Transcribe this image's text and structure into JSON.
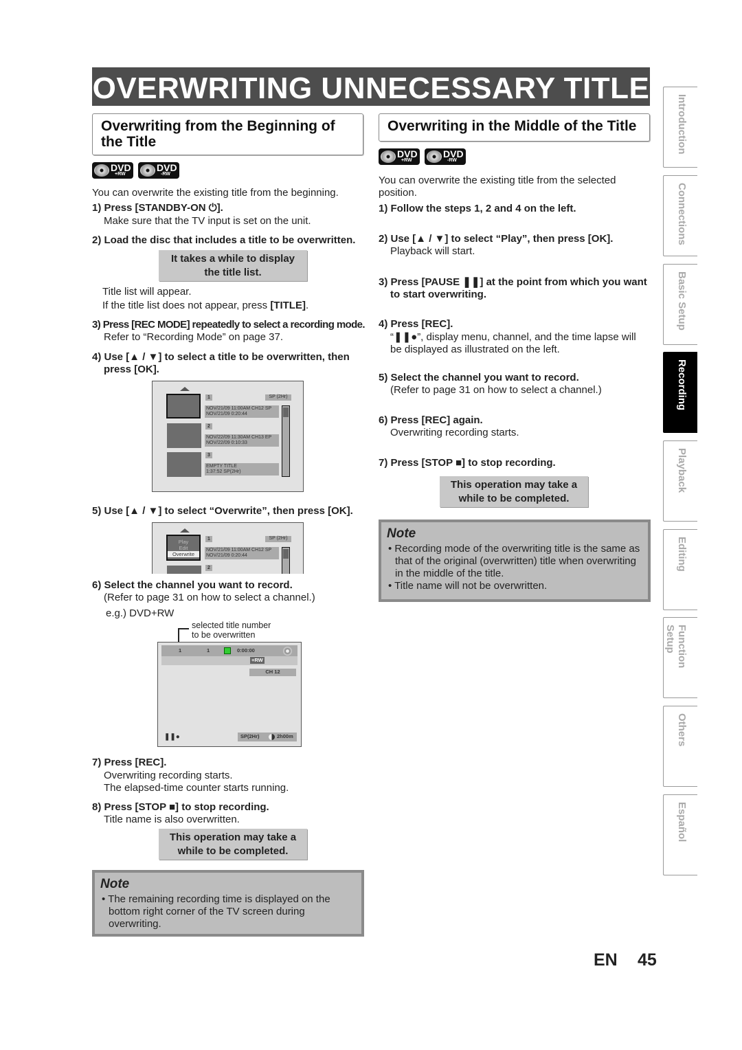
{
  "title": "OVERWRITING UNNECESSARY TITLE",
  "left": {
    "heading": [
      "Overwriting from the Beginning of",
      "the Title"
    ],
    "logos": [
      {
        "main": "DVD",
        "sub": "+RW"
      },
      {
        "main": "DVD",
        "sub": "-RW"
      }
    ],
    "intro": "You can overwrite the existing title from the beginning.",
    "s1": "1) Press [STANDBY-ON ⏻].",
    "s1a": "Make sure that the TV input is set on the unit.",
    "s2": "2) Load the disc that includes a title to be overwritten.",
    "c1": [
      "It takes a while to display",
      "the title list."
    ],
    "s2a": "Title list will appear.",
    "s2b": "If the title list does not appear, press ",
    "s2b_key": "[TITLE]",
    "s3": "3) Press [REC MODE] repeatedly to select a recording mode.",
    "s3a": "Refer to “Recording Mode” on page 37.",
    "s4": [
      "4) Use [▲ / ▼] to select a title to be overwritten, then",
      "press [OK]."
    ],
    "list": {
      "mode": "SP (2Hr)",
      "titles": [
        {
          "n": "1",
          "l1": "NOV/21/09  11:00AM CH12  SP",
          "l2": "NOV/21/09    0:20:44"
        },
        {
          "n": "2",
          "l1": "NOV/22/09  11:30AM CH13  EP",
          "l2": "NOV/22/09    0:10:33"
        },
        {
          "n": "3",
          "l1": "EMPTY TITLE",
          "l2": "1:37:52  SP(2Hr)"
        }
      ]
    },
    "s5": "5) Use [▲ / ▼] to select “Overwrite”, then press [OK].",
    "menu": [
      "Play",
      "Edit",
      "Overwrite"
    ],
    "s6": "6) Select the channel you want to record.",
    "s6a": "(Refer to page 31 on how to select a channel.)",
    "s6b": "e.g.) DVD+RW",
    "annot": [
      "selected title number",
      "to be overwritten"
    ],
    "tv": {
      "title": "1",
      "chapter": "1",
      "time": "0:00:00",
      "disc": "+RW",
      "channel": "CH  12",
      "mode": "SP(2Hr)",
      "remain": "2h00m"
    },
    "s7": "7) Press [REC].",
    "s7a": "Overwriting recording starts.",
    "s7b": "The elapsed-time counter starts running.",
    "s8": "8) Press [STOP ■] to stop recording.",
    "s8a": "Title name is also overwritten.",
    "c2": [
      "This operation may take a",
      "while to be completed."
    ],
    "note": {
      "title": "Note",
      "items": [
        "The remaining recording time is displayed on the bottom right corner of the TV screen during overwriting."
      ]
    }
  },
  "right": {
    "heading": "Overwriting in the Middle of the Title",
    "intro": [
      "You can overwrite the existing title from the selected",
      "position."
    ],
    "s1": "1) Follow the steps 1, 2 and 4 on the left.",
    "s2": "2) Use [▲ / ▼] to select “Play”, then press [OK].",
    "s2a": "Playback will start.",
    "s3": [
      "3) Press [PAUSE ❚❚] at the point from which you want",
      "to start overwriting."
    ],
    "s4": "4) Press [REC].",
    "s4a": "“❚❚●”, display menu, channel, and the time lapse will",
    "s4b": "be displayed as illustrated on the left.",
    "s5": "5) Select the channel you want to record.",
    "s5a": "(Refer to page 31 on how to select a channel.)",
    "s6": "6) Press [REC] again.",
    "s6a": "Overwriting recording starts.",
    "s7": "7) Press [STOP ■] to stop recording.",
    "c1": [
      "This operation may take a",
      "while to be completed."
    ],
    "note": {
      "title": "Note",
      "items": [
        "Recording mode of the overwriting title is the same as that of the original (overwritten) title when overwriting in the middle of the title.",
        "Title name will not be overwritten."
      ]
    }
  },
  "sidebar": {
    "active": "Recording",
    "tabs": [
      "Introduction",
      "Connections",
      "Basic Setup",
      "Recording",
      "Playback",
      "Editing",
      "Function Setup",
      "Others",
      "Español"
    ]
  },
  "footer": {
    "lang": "EN",
    "page": "45"
  }
}
